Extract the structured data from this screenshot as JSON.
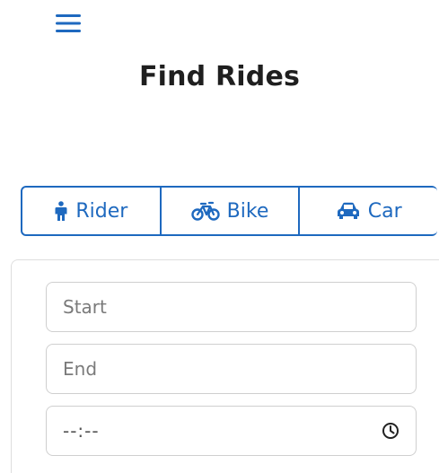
{
  "header": {
    "menu_icon": "hamburger-menu-icon",
    "title": "Find Rides"
  },
  "modes": [
    {
      "label": "Rider",
      "icon": "person-icon"
    },
    {
      "label": "Bike",
      "icon": "bicycle-icon"
    },
    {
      "label": "Car",
      "icon": "car-icon"
    }
  ],
  "form": {
    "start": {
      "placeholder": "Start",
      "value": ""
    },
    "end": {
      "placeholder": "End",
      "value": ""
    },
    "time": {
      "value": "--:--",
      "icon": "clock-icon"
    }
  },
  "colors": {
    "accent": "#1e69bf",
    "border": "#cfcfcf"
  }
}
